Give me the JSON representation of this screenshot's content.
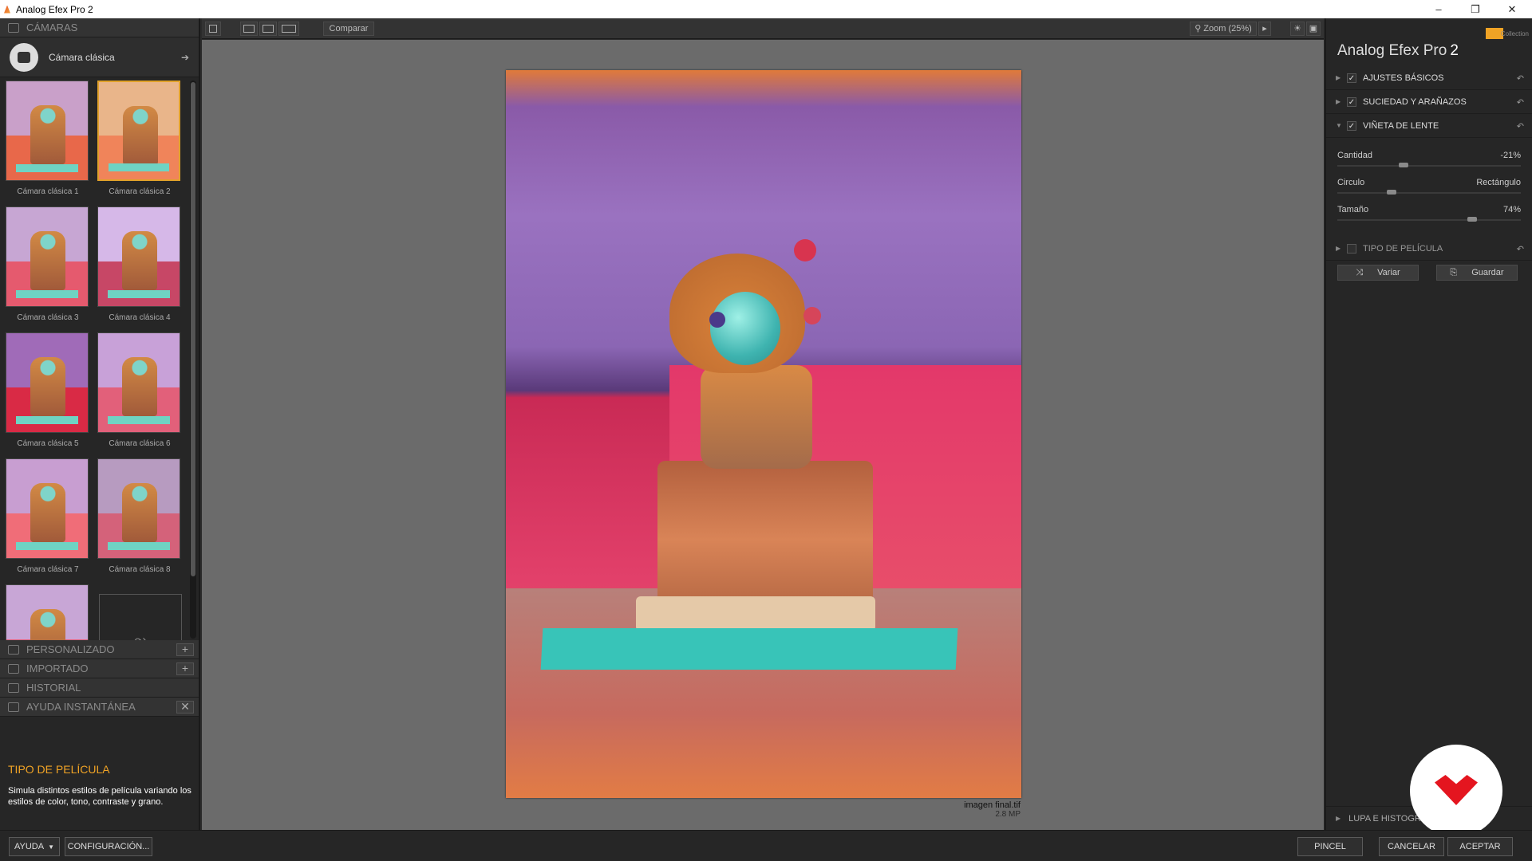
{
  "window": {
    "title": "Analog Efex Pro 2",
    "controls": [
      "–",
      "❐",
      "✕"
    ]
  },
  "left": {
    "cameras_header": "CÁMARAS",
    "camera_name": "Cámara clásica",
    "presets": [
      {
        "label": "Cámara clásica 1",
        "selected": false,
        "tint_top": "#c9a0c9",
        "tint_bottom": "#e8684a"
      },
      {
        "label": "Cámara clásica 2",
        "selected": true,
        "tint_top": "#e9b58a",
        "tint_bottom": "#f0845a"
      },
      {
        "label": "Cámara clásica 3",
        "selected": false,
        "tint_top": "#c7a6d3",
        "tint_bottom": "#e55a6e"
      },
      {
        "label": "Cámara clásica 4",
        "selected": false,
        "tint_top": "#d6b8e8",
        "tint_bottom": "#c74766"
      },
      {
        "label": "Cámara clásica 5",
        "selected": false,
        "tint_top": "#a06bb8",
        "tint_bottom": "#d92a45"
      },
      {
        "label": "Cámara clásica 6",
        "selected": false,
        "tint_top": "#c8a1d8",
        "tint_bottom": "#e2607a"
      },
      {
        "label": "Cámara clásica 7",
        "selected": false,
        "tint_top": "#c89ed1",
        "tint_bottom": "#f06d78"
      },
      {
        "label": "Cámara clásica 8",
        "selected": false,
        "tint_top": "#b79bc0",
        "tint_bottom": "#d4627a"
      }
    ],
    "sections": {
      "personalizado": "PERSONALIZADO",
      "importado": "IMPORTADO",
      "historial": "HISTORIAL",
      "ayuda": "AYUDA INSTANTÁNEA"
    },
    "help": {
      "title": "TIPO DE PELÍCULA",
      "text": "Simula distintos estilos de película variando los estilos de color, tono, contraste y grano."
    }
  },
  "toolbar": {
    "compare": "Comparar",
    "zoom": "Zoom (25%)"
  },
  "photo": {
    "filename": "imagen final.tif",
    "size": "2.8 MP"
  },
  "right": {
    "collection": "Collection",
    "app_name": "Analog Efex Pro",
    "app_version": "2",
    "sections": [
      {
        "label": "AJUSTES BÁSICOS",
        "checked": true,
        "expanded": false
      },
      {
        "label": "SUCIEDAD Y ARAÑAZOS",
        "checked": true,
        "expanded": false
      },
      {
        "label": "VIÑETA DE LENTE",
        "checked": true,
        "expanded": true
      }
    ],
    "sliders": {
      "cantidad": {
        "label": "Cantidad",
        "value": "-21%",
        "fraction": 0.35
      },
      "forma": {
        "label": "Circulo",
        "right_label": "Rectángulo",
        "fraction": 0.28
      },
      "tamano": {
        "label": "Tamaño",
        "value": "74%",
        "fraction": 0.74
      }
    },
    "film_section": {
      "label": "TIPO DE PELÍCULA",
      "checked": false
    },
    "variar": "Variar",
    "guardar": "Guardar",
    "lupa": "LUPA E HISTOGR"
  },
  "statusbar": {
    "ayuda": "AYUDA",
    "config": "CONFIGURACIÓN...",
    "pincel": "PINCEL",
    "cancelar": "CANCELAR",
    "aceptar": "ACEPTAR"
  },
  "colors": {
    "accent": "#f0a325",
    "panel": "#262626",
    "canvas": "#6b6b6b"
  }
}
